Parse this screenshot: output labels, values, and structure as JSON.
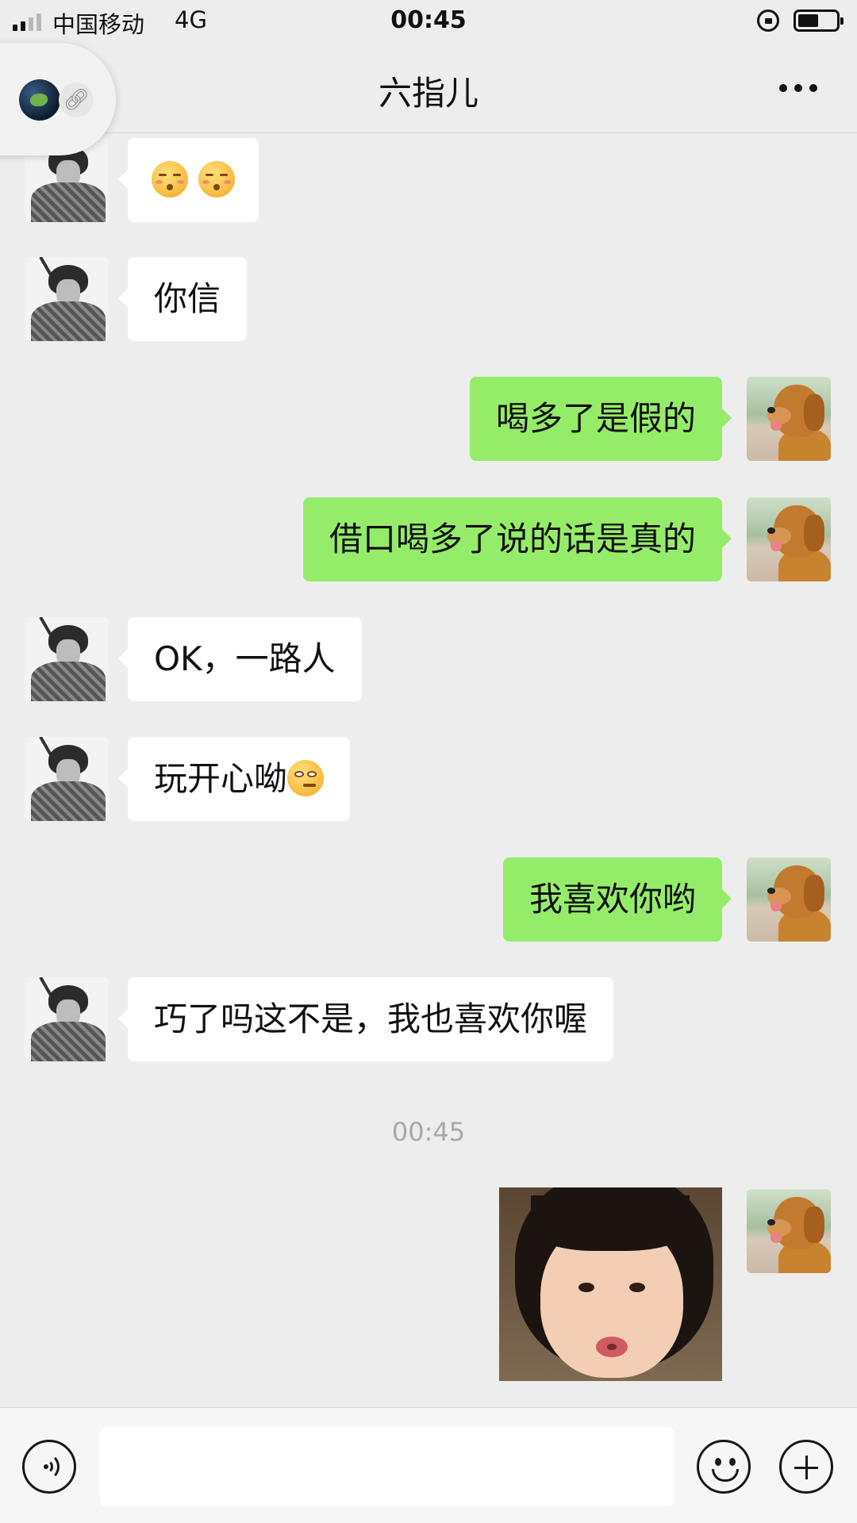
{
  "status_bar": {
    "carrier": "中国移动",
    "network": "4G",
    "time": "00:45",
    "battery_level": 0.55,
    "icons": [
      "signal-icon",
      "rotation-lock-icon",
      "battery-icon"
    ]
  },
  "header": {
    "title": "六指儿",
    "more_icon": "more-dots-icon",
    "floating_window_icons": [
      "floating-avatar-icon",
      "link-icon"
    ]
  },
  "messages": [
    {
      "side": "left",
      "type": "emoji",
      "emojis": [
        "kissing-blush-emoji",
        "kissing-blush-emoji"
      ]
    },
    {
      "side": "left",
      "type": "text",
      "text": "你信"
    },
    {
      "side": "right",
      "type": "text",
      "text": "喝多了是假的"
    },
    {
      "side": "right",
      "type": "text",
      "text": "借口喝多了说的话是真的"
    },
    {
      "side": "left",
      "type": "text",
      "text": "OK，一路人"
    },
    {
      "side": "left",
      "type": "text",
      "text": "玩开心呦",
      "emoji": "smirk-emoji"
    },
    {
      "side": "right",
      "type": "text",
      "text": "我喜欢你哟"
    },
    {
      "side": "left",
      "type": "text",
      "text": "巧了吗这不是，我也喜欢你喔"
    },
    {
      "side": "right",
      "type": "image",
      "image": "girl-pouting-sticker"
    }
  ],
  "time_separator": "00:45",
  "input_bar": {
    "placeholder": "",
    "icons": [
      "voice-icon",
      "emoji-icon",
      "plus-icon"
    ]
  },
  "colors": {
    "background": "#ededed",
    "sent_bubble": "#95ec69",
    "received_bubble": "#ffffff"
  }
}
